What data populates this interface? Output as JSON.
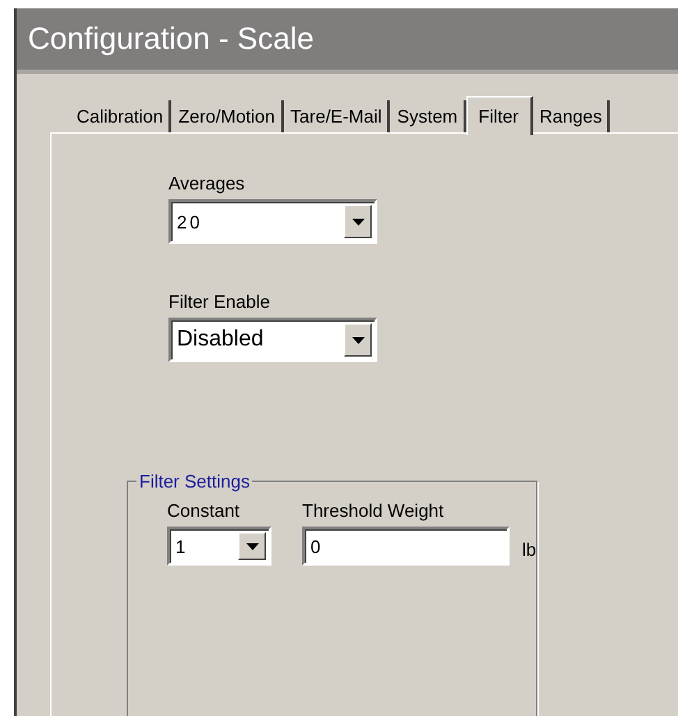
{
  "window": {
    "title": "Configuration - Scale"
  },
  "tabs": [
    {
      "label": "Calibration",
      "selected": false
    },
    {
      "label": "Zero/Motion",
      "selected": false
    },
    {
      "label": "Tare/E-Mail",
      "selected": false
    },
    {
      "label": "System",
      "selected": false
    },
    {
      "label": "Filter",
      "selected": true
    },
    {
      "label": "Ranges",
      "selected": false
    }
  ],
  "averages": {
    "label": "Averages",
    "value": "20"
  },
  "filter_enable": {
    "label": "Filter Enable",
    "value": "Disabled"
  },
  "filter_settings": {
    "title": "Filter Settings",
    "constant": {
      "label": "Constant",
      "value": "1"
    },
    "threshold_weight": {
      "label": "Threshold Weight",
      "value": "0",
      "unit": "lb"
    }
  }
}
